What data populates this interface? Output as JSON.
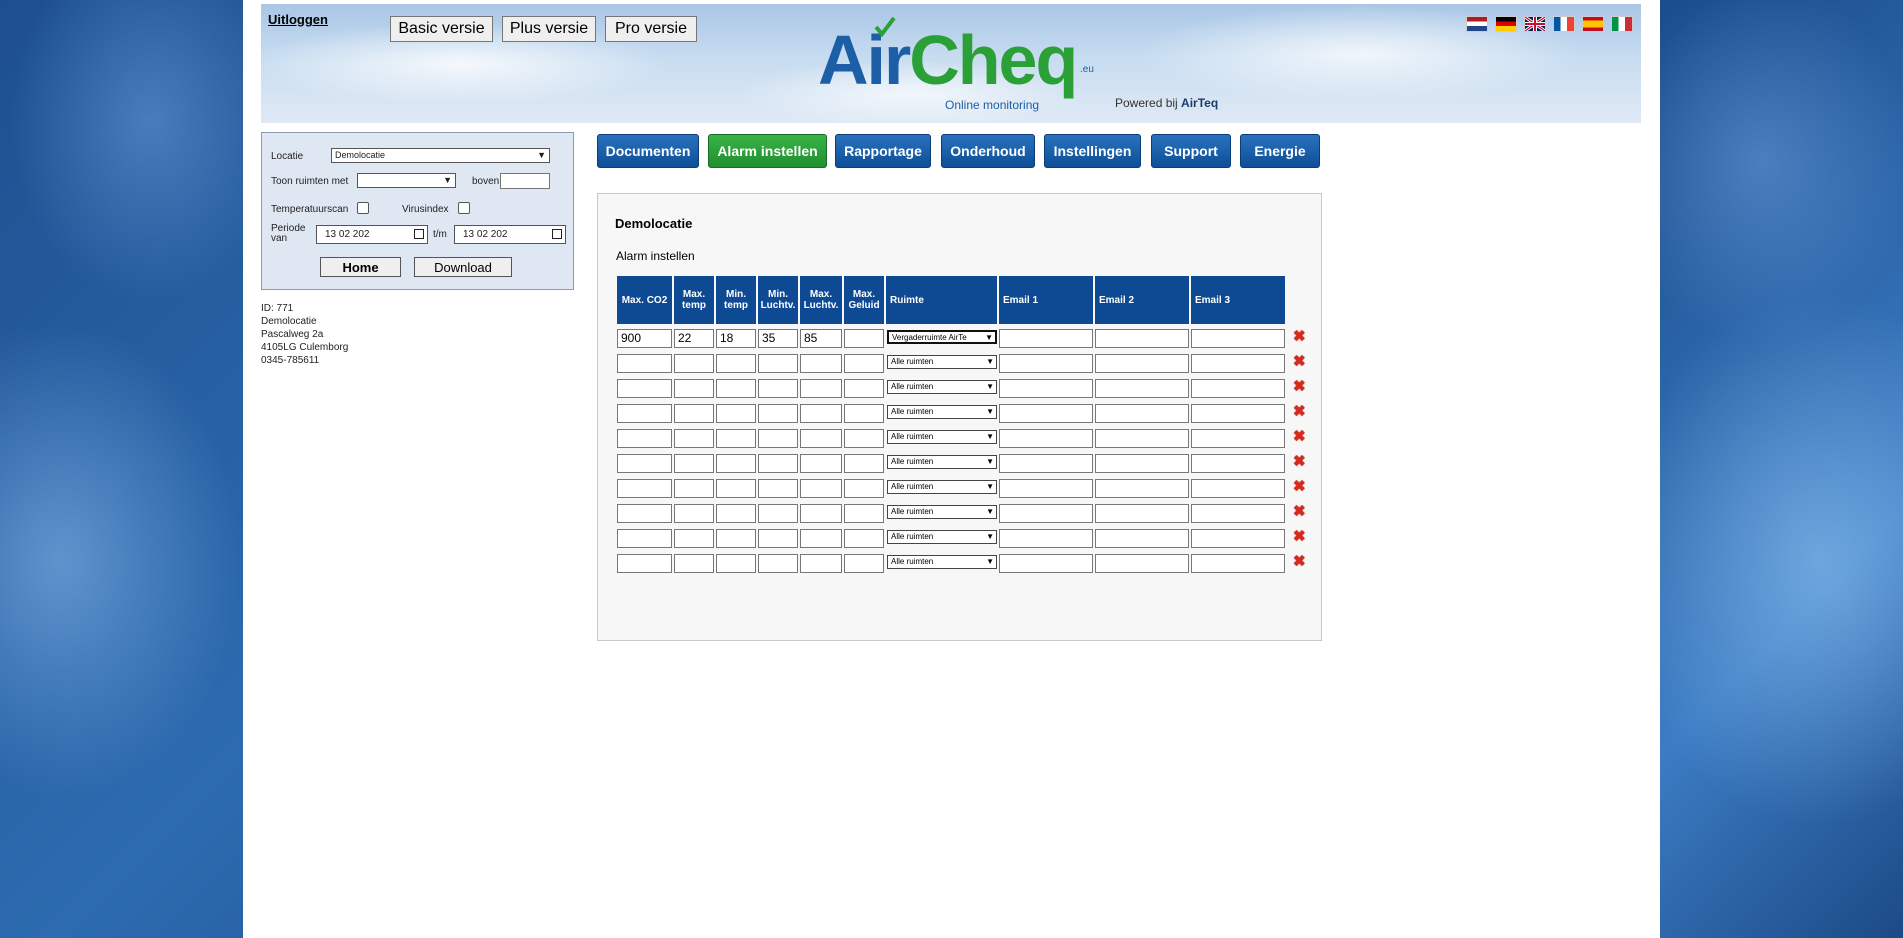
{
  "header": {
    "logout_label": "Uitloggen",
    "versions": [
      "Basic versie",
      "Plus versie",
      "Pro versie"
    ],
    "logo": {
      "air": "Air",
      "cheq": "Cheq",
      "domain": ".eu",
      "tagline": "Online monitoring"
    },
    "powered_by": {
      "prefix": "Powered bij",
      "brand": "AirTeq"
    },
    "flags": [
      "nl",
      "de",
      "gb",
      "fr",
      "es",
      "it"
    ]
  },
  "filter": {
    "locatie_label": "Locatie",
    "locatie_value": "Demolocatie",
    "toon_label": "Toon ruimten met",
    "toon_value": "",
    "boven_label": "boven",
    "boven_value": "",
    "temperatuurscan_label": "Temperatuurscan",
    "virusindex_label": "Virusindex",
    "periode_label_1": "Periode",
    "periode_label_2": "van",
    "periode_from": "13 02 202",
    "tm_label": "t/m",
    "periode_to": "13 02 202",
    "home_label": "Home",
    "download_label": "Download"
  },
  "address": {
    "id": "ID: 771",
    "name": "Demolocatie",
    "street": "Pascalweg 2a",
    "city": "4105LG Culemborg",
    "phone": "0345-785611"
  },
  "nav": [
    "Documenten",
    "Alarm instellen",
    "Rapportage",
    "Onderhoud",
    "Instellingen",
    "Support",
    "Energie"
  ],
  "panel": {
    "title": "Demolocatie",
    "subtitle": "Alarm instellen",
    "columns": [
      "Max. CO2",
      "Max. temp",
      "Min. temp",
      "Min. Luchtv.",
      "Max. Luchtv.",
      "Max. Geluid",
      "Ruimte",
      "Email 1",
      "Email 2",
      "Email 3"
    ],
    "rows": [
      {
        "max_co2": "900",
        "max_temp": "22",
        "min_temp": "18",
        "min_luchtv": "35",
        "max_luchtv": "85",
        "max_geluid": "",
        "ruimte": "Vergaderruimte AirTe",
        "email1": "",
        "email2": "",
        "email3": ""
      },
      {
        "max_co2": "",
        "max_temp": "",
        "min_temp": "",
        "min_luchtv": "",
        "max_luchtv": "",
        "max_geluid": "",
        "ruimte": "Alle ruimten",
        "email1": "",
        "email2": "",
        "email3": ""
      },
      {
        "max_co2": "",
        "max_temp": "",
        "min_temp": "",
        "min_luchtv": "",
        "max_luchtv": "",
        "max_geluid": "",
        "ruimte": "Alle ruimten",
        "email1": "",
        "email2": "",
        "email3": ""
      },
      {
        "max_co2": "",
        "max_temp": "",
        "min_temp": "",
        "min_luchtv": "",
        "max_luchtv": "",
        "max_geluid": "",
        "ruimte": "Alle ruimten",
        "email1": "",
        "email2": "",
        "email3": ""
      },
      {
        "max_co2": "",
        "max_temp": "",
        "min_temp": "",
        "min_luchtv": "",
        "max_luchtv": "",
        "max_geluid": "",
        "ruimte": "Alle ruimten",
        "email1": "",
        "email2": "",
        "email3": ""
      },
      {
        "max_co2": "",
        "max_temp": "",
        "min_temp": "",
        "min_luchtv": "",
        "max_luchtv": "",
        "max_geluid": "",
        "ruimte": "Alle ruimten",
        "email1": "",
        "email2": "",
        "email3": ""
      },
      {
        "max_co2": "",
        "max_temp": "",
        "min_temp": "",
        "min_luchtv": "",
        "max_luchtv": "",
        "max_geluid": "",
        "ruimte": "Alle ruimten",
        "email1": "",
        "email2": "",
        "email3": ""
      },
      {
        "max_co2": "",
        "max_temp": "",
        "min_temp": "",
        "min_luchtv": "",
        "max_luchtv": "",
        "max_geluid": "",
        "ruimte": "Alle ruimten",
        "email1": "",
        "email2": "",
        "email3": ""
      },
      {
        "max_co2": "",
        "max_temp": "",
        "min_temp": "",
        "min_luchtv": "",
        "max_luchtv": "",
        "max_geluid": "",
        "ruimte": "Alle ruimten",
        "email1": "",
        "email2": "",
        "email3": ""
      },
      {
        "max_co2": "",
        "max_temp": "",
        "min_temp": "",
        "min_luchtv": "",
        "max_luchtv": "",
        "max_geluid": "",
        "ruimte": "Alle ruimten",
        "email1": "",
        "email2": "",
        "email3": ""
      }
    ]
  },
  "colors": {
    "nav_blue": "#0e4a93",
    "nav_active_green": "#2aa037",
    "table_header": "#0e4a93",
    "delete_red": "#d42b1f"
  }
}
